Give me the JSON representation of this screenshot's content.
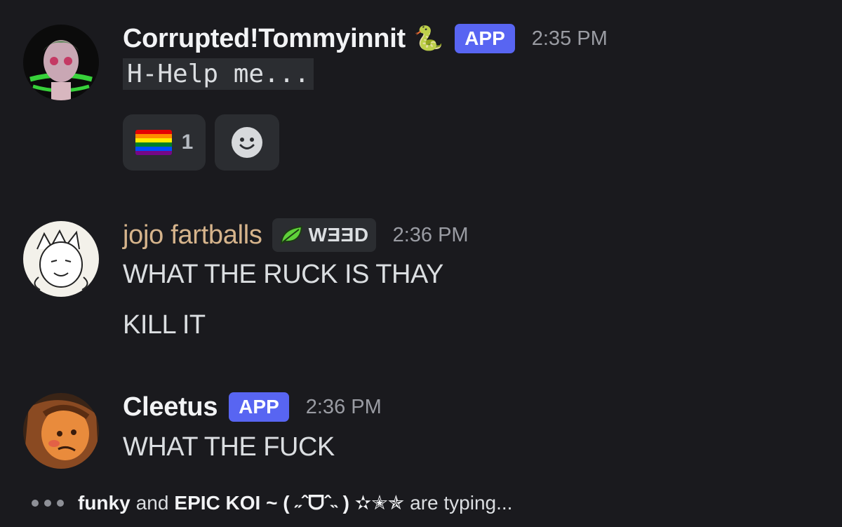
{
  "messages": [
    {
      "username": "Corrupted!Tommyinnit",
      "username_emoji": "🐍",
      "badge": "APP",
      "timestamp": "2:35 PM",
      "lines": [
        "H-Help me..."
      ],
      "reactions": [
        {
          "emoji": "🏳️‍🌈",
          "count": "1"
        }
      ]
    },
    {
      "username": "jojo fartballs",
      "tag": {
        "icon": "leaf-icon",
        "label": "WƎƎD"
      },
      "timestamp": "2:36 PM",
      "lines": [
        "WHAT THE RUCK IS THAY",
        "KILL IT"
      ]
    },
    {
      "username": "Cleetus",
      "badge": "APP",
      "timestamp": "2:36 PM",
      "lines": [
        "WHAT THE FUCK"
      ]
    }
  ],
  "typing": {
    "user1": "funky",
    "joiner": "and",
    "user2": "EPIC KOI ~ ( ˶ˆᗜˆ˵ ) ✫✭✯",
    "suffix": "are typing..."
  },
  "colors": {
    "background": "#1a1a1e",
    "app_badge": "#5865f2",
    "jojo_name": "#d6b48c",
    "timestamp": "#9a9ca3"
  }
}
